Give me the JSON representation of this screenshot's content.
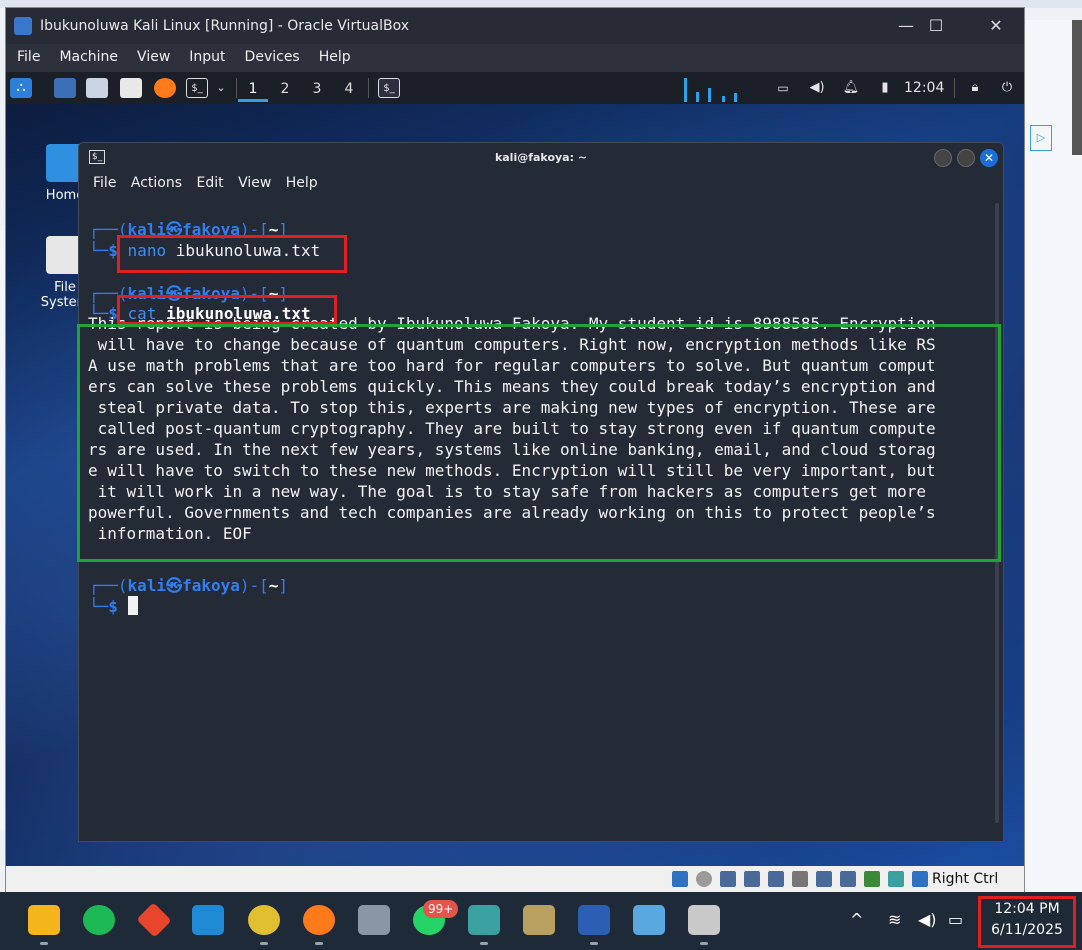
{
  "vbox": {
    "title": "Ibukunoluwa Kali Linux [Running] - Oracle VirtualBox",
    "menu": [
      "File",
      "Machine",
      "View",
      "Input",
      "Devices",
      "Help"
    ],
    "host_key": "Right Ctrl"
  },
  "panel": {
    "workspaces": [
      "1",
      "2",
      "3",
      "4"
    ],
    "active_workspace": "1",
    "time": "12:04"
  },
  "desktop": {
    "icons": [
      "Home",
      "File System"
    ]
  },
  "terminal": {
    "title": "kali@fakoya: ~",
    "menu": [
      "File",
      "Actions",
      "Edit",
      "View",
      "Help"
    ],
    "prompt_user": "kali",
    "prompt_sep": "㉿",
    "prompt_host": "fakoya",
    "prompt_dir": "~",
    "cmd1_name": "nano",
    "cmd1_arg": "ibukunoluwa.txt",
    "cmd2_name": "cat",
    "cmd2_arg": "ibukunoluwa.txt",
    "output": "This report is being created by Ibukunoluwa Fakoya. My student id is 8988585. Encryption\n will have to change because of quantum computers. Right now, encryption methods like RS\nA use math problems that are too hard for regular computers to solve. But quantum comput\ners can solve these problems quickly. This means they could break today’s encryption and\n steal private data. To stop this, experts are making new types of encryption. These are\n called post-quantum cryptography. They are built to stay strong even if quantum compute\nrs are used. In the next few years, systems like online banking, email, and cloud storag\ne will have to switch to these new methods. Encryption will still be very important, but\n it will work in a new way. The goal is to stay safe from hackers as computers get more\npowerful. Governments and tech companies are already working on this to protect people’s\n information. EOF"
  },
  "taskbar": {
    "notification_badge": "99+",
    "clock_time": "12:04 PM",
    "clock_date": "6/11/2025"
  },
  "colors": {
    "kali_blue": "#2f7ff0",
    "highlight_red": "#e02020",
    "highlight_green": "#1fa43a"
  }
}
